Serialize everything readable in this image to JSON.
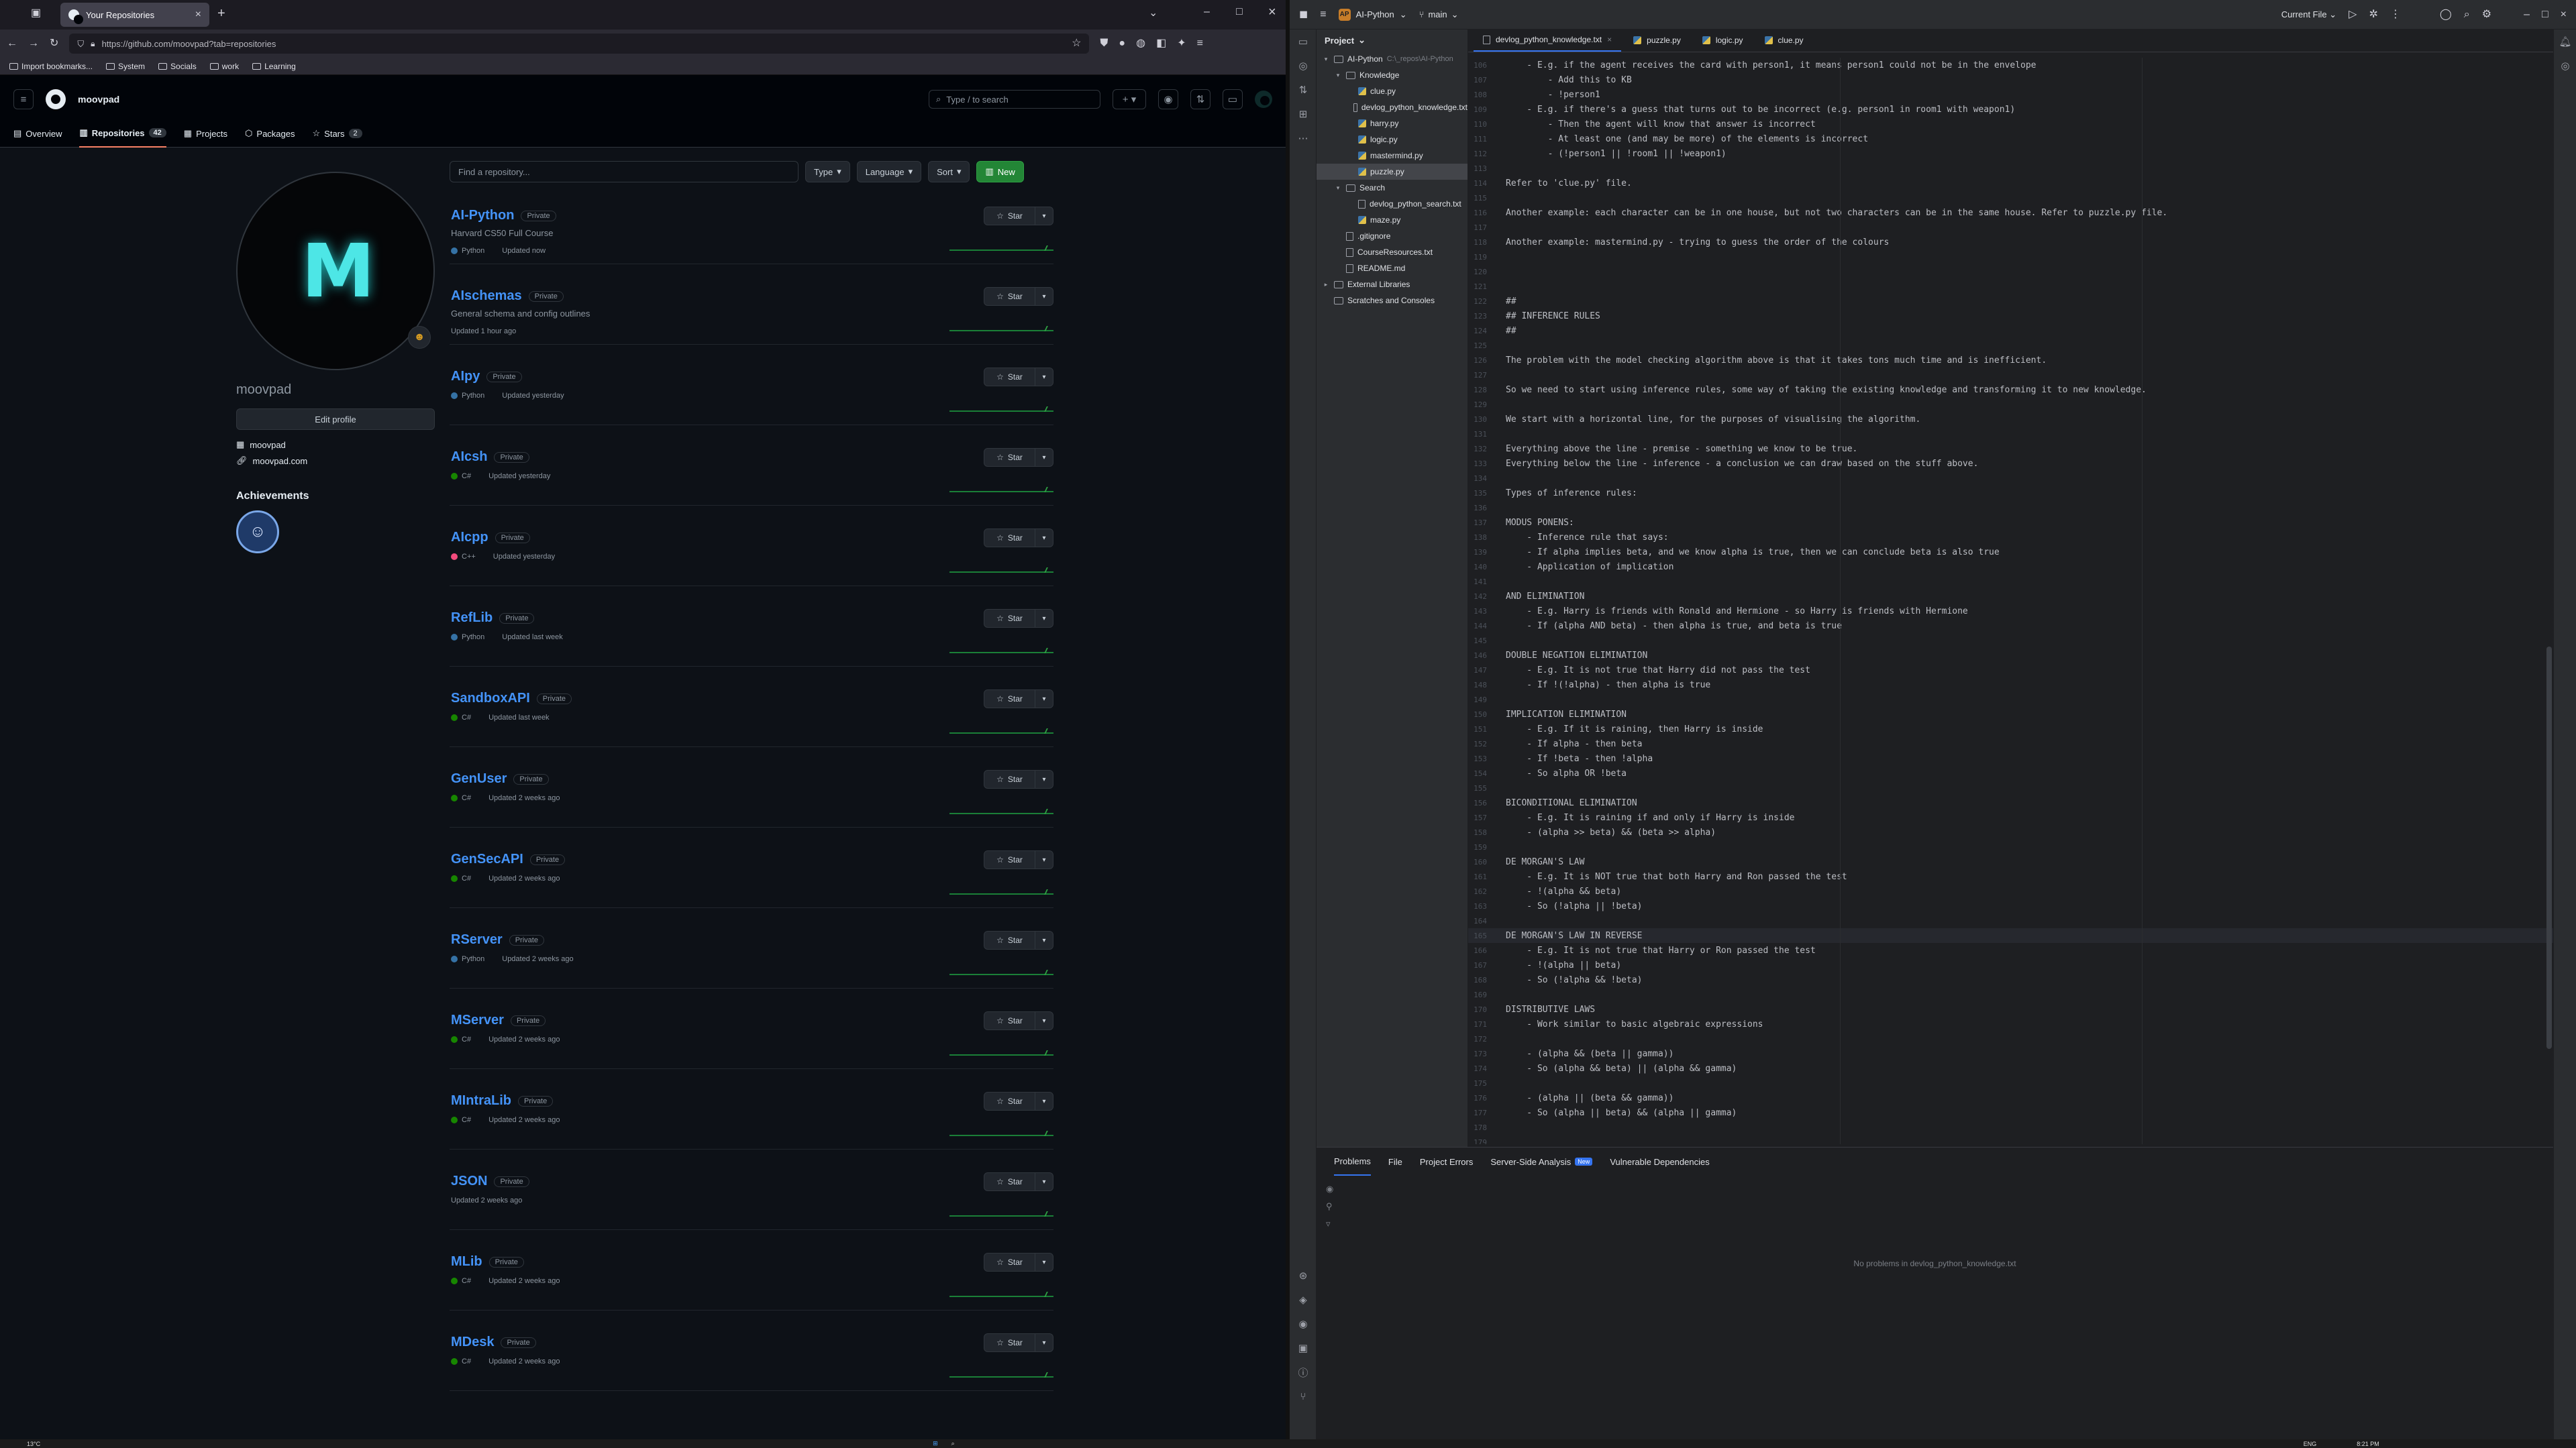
{
  "browser": {
    "tab_title": "Your Repositories",
    "url": "https://github.com/moovpad?tab=repositories",
    "bookmarks": [
      "Import bookmarks...",
      "System",
      "Socials",
      "work",
      "Learning"
    ]
  },
  "github": {
    "username": "moovpad",
    "search_placeholder": "Type / to search",
    "nav_tabs": [
      {
        "label": "Overview",
        "count": ""
      },
      {
        "label": "Repositories",
        "count": "42"
      },
      {
        "label": "Projects",
        "count": ""
      },
      {
        "label": "Packages",
        "count": ""
      },
      {
        "label": "Stars",
        "count": "2"
      }
    ],
    "profile": {
      "avatar_text": "M",
      "login": "moovpad",
      "edit_label": "Edit profile",
      "org": "moovpad",
      "website": "moovpad.com",
      "achievements_title": "Achievements"
    },
    "repo_filter": {
      "placeholder": "Find a repository...",
      "type_label": "Type",
      "language_label": "Language",
      "sort_label": "Sort",
      "new_label": "New"
    },
    "star_label": "Star",
    "private_label": "Private",
    "repos": [
      {
        "name": "AI-Python",
        "desc": "Harvard CS50 Full Course",
        "lang": "Python",
        "lang_color": "#3572A5",
        "updated": "Updated now"
      },
      {
        "name": "AIschemas",
        "desc": "General schema and config outlines",
        "lang": "",
        "lang_color": "",
        "updated": "Updated 1 hour ago"
      },
      {
        "name": "AIpy",
        "desc": "",
        "lang": "Python",
        "lang_color": "#3572A5",
        "updated": "Updated yesterday"
      },
      {
        "name": "AIcsh",
        "desc": "",
        "lang": "C#",
        "lang_color": "#178600",
        "updated": "Updated yesterday"
      },
      {
        "name": "AIcpp",
        "desc": "",
        "lang": "C++",
        "lang_color": "#f34b7d",
        "updated": "Updated yesterday"
      },
      {
        "name": "RefLib",
        "desc": "",
        "lang": "Python",
        "lang_color": "#3572A5",
        "updated": "Updated last week"
      },
      {
        "name": "SandboxAPI",
        "desc": "",
        "lang": "C#",
        "lang_color": "#178600",
        "updated": "Updated last week"
      },
      {
        "name": "GenUser",
        "desc": "",
        "lang": "C#",
        "lang_color": "#178600",
        "updated": "Updated 2 weeks ago"
      },
      {
        "name": "GenSecAPI",
        "desc": "",
        "lang": "C#",
        "lang_color": "#178600",
        "updated": "Updated 2 weeks ago"
      },
      {
        "name": "RServer",
        "desc": "",
        "lang": "Python",
        "lang_color": "#3572A5",
        "updated": "Updated 2 weeks ago"
      },
      {
        "name": "MServer",
        "desc": "",
        "lang": "C#",
        "lang_color": "#178600",
        "updated": "Updated 2 weeks ago"
      },
      {
        "name": "MIntraLib",
        "desc": "",
        "lang": "C#",
        "lang_color": "#178600",
        "updated": "Updated 2 weeks ago"
      },
      {
        "name": "JSON",
        "desc": "",
        "lang": "",
        "lang_color": "",
        "updated": "Updated 2 weeks ago"
      },
      {
        "name": "MLib",
        "desc": "",
        "lang": "C#",
        "lang_color": "#178600",
        "updated": "Updated 2 weeks ago"
      },
      {
        "name": "MDesk",
        "desc": "",
        "lang": "C#",
        "lang_color": "#178600",
        "updated": "Updated 2 weeks ago"
      }
    ]
  },
  "ide": {
    "project_name": "AI-Python",
    "branch": "main",
    "run_config": "Current File",
    "panel_title": "Project",
    "tree": [
      {
        "depth": 0,
        "kind": "folder",
        "arrow": "▾",
        "label": "AI-Python",
        "dim": "C:\\_repos\\AI-Python"
      },
      {
        "depth": 1,
        "kind": "folder",
        "arrow": "▾",
        "label": "Knowledge",
        "dim": ""
      },
      {
        "depth": 2,
        "kind": "py",
        "arrow": "",
        "label": "clue.py",
        "dim": ""
      },
      {
        "depth": 2,
        "kind": "txt",
        "arrow": "",
        "label": "devlog_python_knowledge.txt",
        "dim": ""
      },
      {
        "depth": 2,
        "kind": "py",
        "arrow": "",
        "label": "harry.py",
        "dim": ""
      },
      {
        "depth": 2,
        "kind": "py",
        "arrow": "",
        "label": "logic.py",
        "dim": ""
      },
      {
        "depth": 2,
        "kind": "py",
        "arrow": "",
        "label": "mastermind.py",
        "dim": ""
      },
      {
        "depth": 2,
        "kind": "py",
        "arrow": "",
        "label": "puzzle.py",
        "dim": "",
        "selected": true
      },
      {
        "depth": 1,
        "kind": "folder",
        "arrow": "▾",
        "label": "Search",
        "dim": ""
      },
      {
        "depth": 2,
        "kind": "txt",
        "arrow": "",
        "label": "devlog_python_search.txt",
        "dim": ""
      },
      {
        "depth": 2,
        "kind": "py",
        "arrow": "",
        "label": "maze.py",
        "dim": ""
      },
      {
        "depth": 1,
        "kind": "txt",
        "arrow": "",
        "label": ".gitignore",
        "dim": ""
      },
      {
        "depth": 1,
        "kind": "txt",
        "arrow": "",
        "label": "CourseResources.txt",
        "dim": ""
      },
      {
        "depth": 1,
        "kind": "txt",
        "arrow": "",
        "label": "README.md",
        "dim": ""
      },
      {
        "depth": 0,
        "kind": "folder",
        "arrow": "▸",
        "label": "External Libraries",
        "dim": ""
      },
      {
        "depth": 0,
        "kind": "folder",
        "arrow": "",
        "label": "Scratches and Consoles",
        "dim": ""
      }
    ],
    "editor_tabs": [
      "devlog_python_knowledge.txt",
      "puzzle.py",
      "logic.py",
      "clue.py"
    ],
    "current_line": 165,
    "code": [
      {
        "n": 106,
        "t": "    - E.g. if the agent receives the card with person1, it means person1 could not be in the envelope"
      },
      {
        "n": 107,
        "t": "        - Add this to KB"
      },
      {
        "n": 108,
        "t": "        - !person1"
      },
      {
        "n": 109,
        "t": "    - E.g. if there's a guess that turns out to be incorrect (e.g. person1 in room1 with weapon1)"
      },
      {
        "n": 110,
        "t": "        - Then the agent will know that answer is incorrect"
      },
      {
        "n": 111,
        "t": "        - At least one (and may be more) of the elements is incorrect"
      },
      {
        "n": 112,
        "t": "        - (!person1 || !room1 || !weapon1)"
      },
      {
        "n": 113,
        "t": ""
      },
      {
        "n": 114,
        "t": "Refer to 'clue.py' file."
      },
      {
        "n": 115,
        "t": ""
      },
      {
        "n": 116,
        "t": "Another example: each character can be in one house, but not two characters can be in the same house. Refer to puzzle.py file."
      },
      {
        "n": 117,
        "t": ""
      },
      {
        "n": 118,
        "t": "Another example: mastermind.py - trying to guess the order of the colours"
      },
      {
        "n": 119,
        "t": ""
      },
      {
        "n": 120,
        "t": ""
      },
      {
        "n": 121,
        "t": ""
      },
      {
        "n": 122,
        "t": "##"
      },
      {
        "n": 123,
        "t": "## INFERENCE RULES"
      },
      {
        "n": 124,
        "t": "##"
      },
      {
        "n": 125,
        "t": ""
      },
      {
        "n": 126,
        "t": "The problem with the model checking algorithm above is that it takes tons much time and is inefficient."
      },
      {
        "n": 127,
        "t": ""
      },
      {
        "n": 128,
        "t": "So we need to start using inference rules, some way of taking the existing knowledge and transforming it to new knowledge."
      },
      {
        "n": 129,
        "t": ""
      },
      {
        "n": 130,
        "t": "We start with a horizontal line, for the purposes of visualising the algorithm."
      },
      {
        "n": 131,
        "t": ""
      },
      {
        "n": 132,
        "t": "Everything above the line - premise - something we know to be true."
      },
      {
        "n": 133,
        "t": "Everything below the line - inference - a conclusion we can draw based on the stuff above."
      },
      {
        "n": 134,
        "t": ""
      },
      {
        "n": 135,
        "t": "Types of inference rules:"
      },
      {
        "n": 136,
        "t": ""
      },
      {
        "n": 137,
        "t": "MODUS PONENS:"
      },
      {
        "n": 138,
        "t": "    - Inference rule that says:"
      },
      {
        "n": 139,
        "t": "    - If alpha implies beta, and we know alpha is true, then we can conclude beta is also true"
      },
      {
        "n": 140,
        "t": "    - Application of implication"
      },
      {
        "n": 141,
        "t": ""
      },
      {
        "n": 142,
        "t": "AND ELIMINATION"
      },
      {
        "n": 143,
        "t": "    - E.g. Harry is friends with Ronald and Hermione - so Harry is friends with Hermione"
      },
      {
        "n": 144,
        "t": "    - If (alpha AND beta) - then alpha is true, and beta is true"
      },
      {
        "n": 145,
        "t": ""
      },
      {
        "n": 146,
        "t": "DOUBLE NEGATION ELIMINATION"
      },
      {
        "n": 147,
        "t": "    - E.g. It is not true that Harry did not pass the test"
      },
      {
        "n": 148,
        "t": "    - If !(!alpha) - then alpha is true"
      },
      {
        "n": 149,
        "t": ""
      },
      {
        "n": 150,
        "t": "IMPLICATION ELIMINATION"
      },
      {
        "n": 151,
        "t": "    - E.g. If it is raining, then Harry is inside"
      },
      {
        "n": 152,
        "t": "    - If alpha - then beta"
      },
      {
        "n": 153,
        "t": "    - If !beta - then !alpha"
      },
      {
        "n": 154,
        "t": "    - So alpha OR !beta"
      },
      {
        "n": 155,
        "t": ""
      },
      {
        "n": 156,
        "t": "BICONDITIONAL ELIMINATION"
      },
      {
        "n": 157,
        "t": "    - E.g. It is raining if and only if Harry is inside"
      },
      {
        "n": 158,
        "t": "    - (alpha >> beta) && (beta >> alpha)"
      },
      {
        "n": 159,
        "t": ""
      },
      {
        "n": 160,
        "t": "DE MORGAN'S LAW"
      },
      {
        "n": 161,
        "t": "    - E.g. It is NOT true that both Harry and Ron passed the test"
      },
      {
        "n": 162,
        "t": "    - !(alpha && beta)"
      },
      {
        "n": 163,
        "t": "    - So (!alpha || !beta)"
      },
      {
        "n": 164,
        "t": ""
      },
      {
        "n": 165,
        "t": "DE MORGAN'S LAW IN REVERSE"
      },
      {
        "n": 166,
        "t": "    - E.g. It is not true that Harry or Ron passed the test"
      },
      {
        "n": 167,
        "t": "    - !(alpha || beta)"
      },
      {
        "n": 168,
        "t": "    - So (!alpha && !beta)"
      },
      {
        "n": 169,
        "t": ""
      },
      {
        "n": 170,
        "t": "DISTRIBUTIVE LAWS"
      },
      {
        "n": 171,
        "t": "    - Work similar to basic algebraic expressions"
      },
      {
        "n": 172,
        "t": ""
      },
      {
        "n": 173,
        "t": "    - (alpha && (beta || gamma))"
      },
      {
        "n": 174,
        "t": "    - So (alpha && beta) || (alpha && gamma)"
      },
      {
        "n": 175,
        "t": ""
      },
      {
        "n": 176,
        "t": "    - (alpha || (beta && gamma))"
      },
      {
        "n": 177,
        "t": "    - So (alpha || beta) && (alpha || gamma)"
      },
      {
        "n": 178,
        "t": ""
      },
      {
        "n": 179,
        "t": ""
      }
    ],
    "problems_tabs": [
      {
        "label": "Problems",
        "badge": ""
      },
      {
        "label": "File",
        "badge": ""
      },
      {
        "label": "Project Errors",
        "badge": ""
      },
      {
        "label": "Server-Side Analysis",
        "badge": "New"
      },
      {
        "label": "Vulnerable Dependencies",
        "badge": ""
      }
    ],
    "no_problems": "No problems in devlog_python_knowledge.txt"
  },
  "taskbar": {
    "weather": "13°C",
    "lang": "ENG",
    "time": "8:21 PM"
  },
  "colors": {
    "accent_blue": "#4493f8",
    "github_green": "#238636",
    "ide_accent": "#3574f0"
  }
}
